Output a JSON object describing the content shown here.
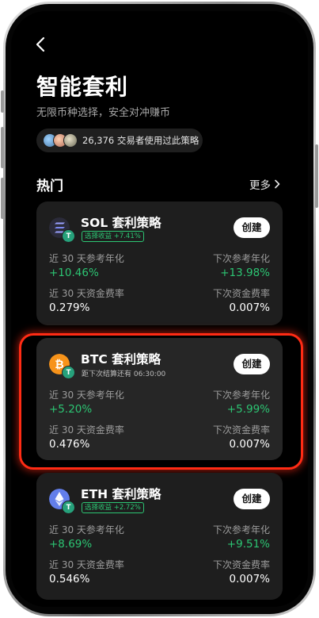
{
  "header": {
    "title": "智能套利",
    "subtitle": "无限币种选择，安全对冲赚币",
    "users_text": "26,376 交易者使用过此策略"
  },
  "section": {
    "title": "热门",
    "more_label": "更多"
  },
  "cards": [
    {
      "name": "SOL 套利策略",
      "tag": "选择收益 +7.41%",
      "create_label": "创建",
      "apr30_label": "近 30 天参考年化",
      "apr30_value": "+10.46%",
      "next_apr_label": "下次参考年化",
      "next_apr_value": "+13.98%",
      "fee30_label": "近 30 天资金费率",
      "fee30_value": "0.279%",
      "next_fee_label": "下次资金费率",
      "next_fee_value": "0.007%"
    },
    {
      "name": "BTC 套利策略",
      "countdown": "距下次结算还有  06:30:00",
      "create_label": "创建",
      "apr30_label": "近 30 天参考年化",
      "apr30_value": "+5.20%",
      "next_apr_label": "下次参考年化",
      "next_apr_value": "+5.99%",
      "fee30_label": "近 30 天资金费率",
      "fee30_value": "0.476%",
      "next_fee_label": "下次资金费率",
      "next_fee_value": "0.007%"
    },
    {
      "name": "ETH 套利策略",
      "tag": "选择收益 +2.72%",
      "create_label": "创建",
      "apr30_label": "近 30 天参考年化",
      "apr30_value": "+8.69%",
      "next_apr_label": "下次参考年化",
      "next_apr_value": "+9.51%",
      "fee30_label": "近 30 天资金费率",
      "fee30_value": "0.546%",
      "next_fee_label": "下次资金费率",
      "next_fee_value": "0.007%"
    }
  ],
  "icons": {
    "back": "chevron-left-icon",
    "more": "chevron-right-icon",
    "sol": "solana-coin-icon",
    "btc": "bitcoin-coin-icon",
    "eth": "ethereum-coin-icon",
    "badge": "tether-badge-icon"
  },
  "colors": {
    "positive": "#2cc573",
    "highlight_border": "#ff2b14",
    "background": "#000000",
    "card": "#1e1e1e"
  }
}
